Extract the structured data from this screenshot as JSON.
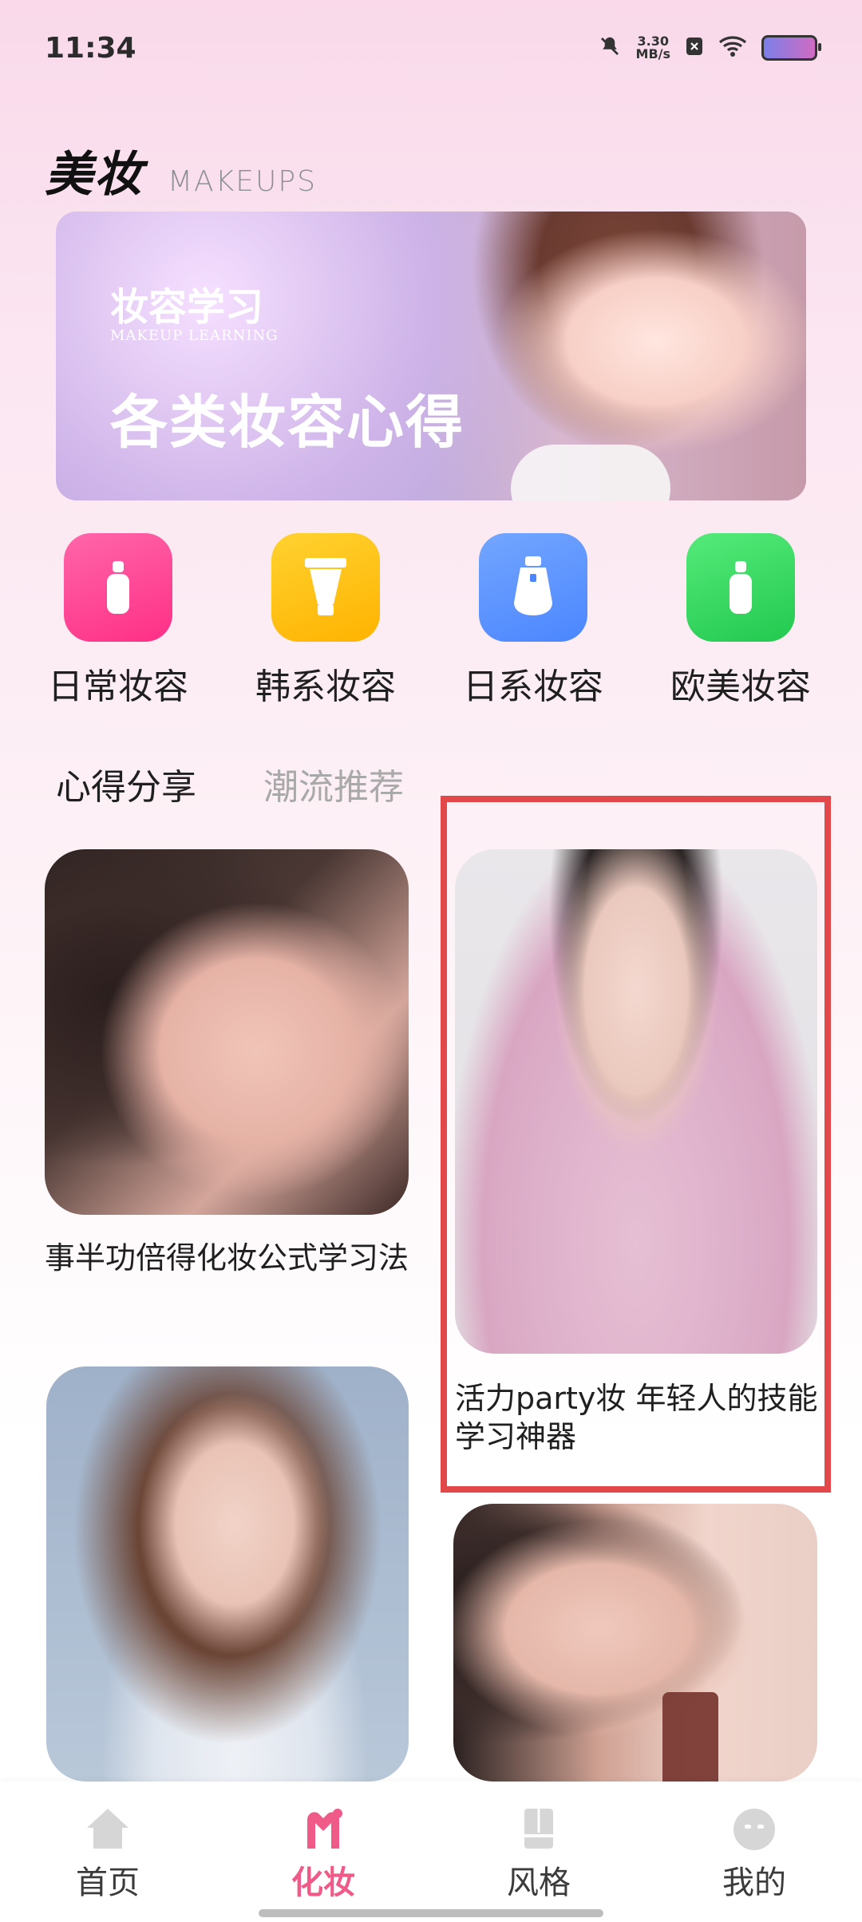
{
  "status_bar": {
    "time": "11:34",
    "network_speed_value": "3.30",
    "network_speed_unit": "MB/s"
  },
  "header": {
    "title_cn": "美妆",
    "title_en": "MAKEUPS"
  },
  "banner": {
    "subtitle": "妆容学习",
    "subtitle_en": "MAKEUP LEARNING",
    "headline": "各类妆容心得"
  },
  "categories": [
    {
      "label": "日常妆容",
      "color_start": "#ff66a9",
      "color_end": "#ff2f86",
      "icon": "bottle-icon"
    },
    {
      "label": "韩系妆容",
      "color_start": "#ffd230",
      "color_end": "#ffb300",
      "icon": "tube-icon"
    },
    {
      "label": "日系妆容",
      "color_start": "#73a6ff",
      "color_end": "#4b86ff",
      "icon": "serum-icon"
    },
    {
      "label": "欧美妆容",
      "color_start": "#55ea7a",
      "color_end": "#22c94f",
      "icon": "bottle-icon"
    }
  ],
  "tabs": {
    "active": "心得分享",
    "inactive": "潮流推荐"
  },
  "feed": [
    {
      "title": "事半功倍得化妆公式学习法"
    },
    {
      "title": "活力party妆  年轻人的技能学习神器"
    }
  ],
  "bottom_nav": [
    {
      "label": "首页",
      "active": false,
      "icon": "home-icon"
    },
    {
      "label": "化妆",
      "active": true,
      "icon": "makeup-icon"
    },
    {
      "label": "风格",
      "active": false,
      "icon": "style-icon"
    },
    {
      "label": "我的",
      "active": false,
      "icon": "profile-icon"
    }
  ],
  "colors": {
    "accent": "#f05a89",
    "highlight_border": "#e2474a"
  }
}
